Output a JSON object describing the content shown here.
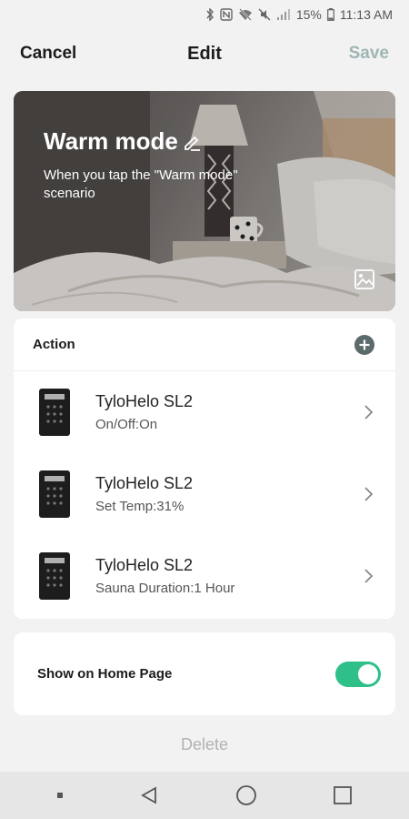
{
  "status_bar": {
    "battery": "15%",
    "time": "11:13 AM"
  },
  "top_bar": {
    "cancel_label": "Cancel",
    "title": "Edit",
    "save_label": "Save"
  },
  "hero": {
    "scene_name": "Warm mode",
    "description": "When you tap the \"Warm mode\" scenario"
  },
  "actions": {
    "header": "Action",
    "items": [
      {
        "device": "TyloHelo SL2",
        "detail": "On/Off:On"
      },
      {
        "device": "TyloHelo SL2",
        "detail": "Set Temp:31%"
      },
      {
        "device": "TyloHelo SL2",
        "detail": "Sauna Duration:1 Hour"
      }
    ]
  },
  "home_toggle": {
    "label": "Show on Home Page",
    "enabled": true
  },
  "delete_label": "Delete",
  "colors": {
    "accent_green": "#2fc08a",
    "save_disabled": "#9fb5b5",
    "add_icon": "#5b6b6b"
  },
  "icons": [
    "bluetooth-icon",
    "nfc-icon",
    "wifi-off-icon",
    "mute-icon",
    "signal-icon",
    "battery-icon",
    "edit-icon",
    "image-icon",
    "add-icon",
    "chevron-right-icon",
    "back-icon",
    "home-icon",
    "recents-icon"
  ]
}
